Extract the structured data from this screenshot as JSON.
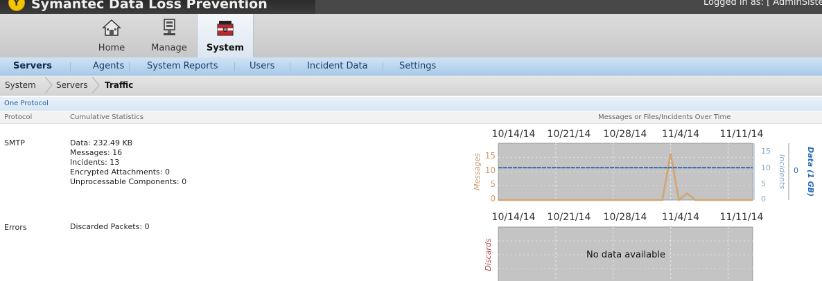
{
  "header": {
    "app_title": "Symantec Data Loss Prevention",
    "logo_glyph": "Y",
    "logged_in": "Logged in as: [ AdminSistema\\"
  },
  "nav": {
    "home": "Home",
    "manage": "Manage",
    "system": "System"
  },
  "tabs": [
    "Servers",
    "Agents",
    "System Reports",
    "Users",
    "Incident Data",
    "Settings"
  ],
  "breadcrumb": [
    "System",
    "Servers",
    "Traffic"
  ],
  "section": {
    "title": "One Protocol",
    "col_protocol": "Protocol",
    "col_stats": "Cumulative Statistics",
    "col_chart": "Messages or Files/Incidents Over Time"
  },
  "rows": {
    "smtp": {
      "label": "SMTP",
      "data": "Data:  232.49 KB",
      "messages": "Messages: 16",
      "incidents": "Incidents: 13",
      "encrypted": "Encrypted Attachments: 0",
      "unprocessable": "Unprocessable Components: 0"
    },
    "errors": {
      "label": "Errors",
      "discarded": "Discarded Packets: 0"
    }
  },
  "colors": {
    "messages": "#d4a373",
    "incidents": "#8aa9c4",
    "data": "#2a6bb5",
    "plot_bg": "#c4c4c4"
  },
  "chart_data": [
    {
      "type": "line",
      "x_ticks": [
        "10/14/14",
        "10/21/14",
        "10/28/14",
        "11/4/14",
        "11/11/14"
      ],
      "ylabel_left": "Messages",
      "ylabel_right": "Incidents",
      "ylabel_right2": "Data (1 GB)",
      "yticks_left": [
        "0",
        "5",
        "10",
        "15"
      ],
      "yticks_right": [
        "0",
        "5",
        "10",
        "15"
      ],
      "yticks_right2": [
        "0"
      ],
      "ylim": [
        0,
        17
      ],
      "series": [
        {
          "name": "Messages",
          "x": [
            "10/14/14",
            "11/1/14",
            "11/2/14",
            "11/3/14",
            "11/4/14",
            "11/5/14",
            "11/6/14",
            "11/7/14",
            "11/14/14"
          ],
          "values": [
            0,
            0,
            0,
            0,
            14,
            0,
            2,
            0,
            0
          ]
        },
        {
          "name": "Data (1 GB)",
          "x": [
            "10/14/14",
            "11/14/14"
          ],
          "values": [
            9.7,
            9.7
          ]
        }
      ]
    },
    {
      "type": "line",
      "x_ticks": [
        "10/14/14",
        "10/21/14",
        "10/28/14",
        "11/4/14",
        "11/11/14"
      ],
      "ylabel_left": "Discards",
      "message": "No data available"
    }
  ]
}
